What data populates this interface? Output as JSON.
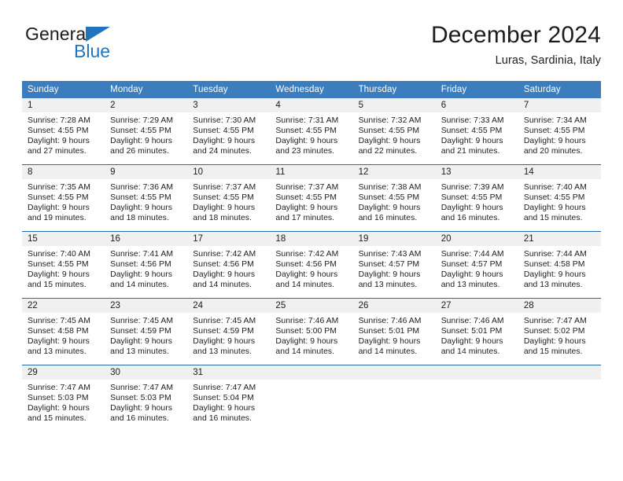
{
  "brand": {
    "name_part1": "General",
    "name_part2": "Blue",
    "triangle_color": "#1f74bd"
  },
  "header": {
    "title": "December 2024",
    "subtitle": "Luras, Sardinia, Italy"
  },
  "theme": {
    "header_bg": "#3b7dbd",
    "header_text": "#ffffff",
    "row_rule": "#2b6ca8",
    "daynum_bg": "#f0f0f0",
    "text": "#1c1c1c",
    "page_bg": "#ffffff"
  },
  "weekday_headers": [
    "Sunday",
    "Monday",
    "Tuesday",
    "Wednesday",
    "Thursday",
    "Friday",
    "Saturday"
  ],
  "weeks": [
    [
      {
        "day": "1",
        "sunrise": "Sunrise: 7:28 AM",
        "sunset": "Sunset: 4:55 PM",
        "daylight1": "Daylight: 9 hours",
        "daylight2": "and 27 minutes."
      },
      {
        "day": "2",
        "sunrise": "Sunrise: 7:29 AM",
        "sunset": "Sunset: 4:55 PM",
        "daylight1": "Daylight: 9 hours",
        "daylight2": "and 26 minutes."
      },
      {
        "day": "3",
        "sunrise": "Sunrise: 7:30 AM",
        "sunset": "Sunset: 4:55 PM",
        "daylight1": "Daylight: 9 hours",
        "daylight2": "and 24 minutes."
      },
      {
        "day": "4",
        "sunrise": "Sunrise: 7:31 AM",
        "sunset": "Sunset: 4:55 PM",
        "daylight1": "Daylight: 9 hours",
        "daylight2": "and 23 minutes."
      },
      {
        "day": "5",
        "sunrise": "Sunrise: 7:32 AM",
        "sunset": "Sunset: 4:55 PM",
        "daylight1": "Daylight: 9 hours",
        "daylight2": "and 22 minutes."
      },
      {
        "day": "6",
        "sunrise": "Sunrise: 7:33 AM",
        "sunset": "Sunset: 4:55 PM",
        "daylight1": "Daylight: 9 hours",
        "daylight2": "and 21 minutes."
      },
      {
        "day": "7",
        "sunrise": "Sunrise: 7:34 AM",
        "sunset": "Sunset: 4:55 PM",
        "daylight1": "Daylight: 9 hours",
        "daylight2": "and 20 minutes."
      }
    ],
    [
      {
        "day": "8",
        "sunrise": "Sunrise: 7:35 AM",
        "sunset": "Sunset: 4:55 PM",
        "daylight1": "Daylight: 9 hours",
        "daylight2": "and 19 minutes."
      },
      {
        "day": "9",
        "sunrise": "Sunrise: 7:36 AM",
        "sunset": "Sunset: 4:55 PM",
        "daylight1": "Daylight: 9 hours",
        "daylight2": "and 18 minutes."
      },
      {
        "day": "10",
        "sunrise": "Sunrise: 7:37 AM",
        "sunset": "Sunset: 4:55 PM",
        "daylight1": "Daylight: 9 hours",
        "daylight2": "and 18 minutes."
      },
      {
        "day": "11",
        "sunrise": "Sunrise: 7:37 AM",
        "sunset": "Sunset: 4:55 PM",
        "daylight1": "Daylight: 9 hours",
        "daylight2": "and 17 minutes."
      },
      {
        "day": "12",
        "sunrise": "Sunrise: 7:38 AM",
        "sunset": "Sunset: 4:55 PM",
        "daylight1": "Daylight: 9 hours",
        "daylight2": "and 16 minutes."
      },
      {
        "day": "13",
        "sunrise": "Sunrise: 7:39 AM",
        "sunset": "Sunset: 4:55 PM",
        "daylight1": "Daylight: 9 hours",
        "daylight2": "and 16 minutes."
      },
      {
        "day": "14",
        "sunrise": "Sunrise: 7:40 AM",
        "sunset": "Sunset: 4:55 PM",
        "daylight1": "Daylight: 9 hours",
        "daylight2": "and 15 minutes."
      }
    ],
    [
      {
        "day": "15",
        "sunrise": "Sunrise: 7:40 AM",
        "sunset": "Sunset: 4:55 PM",
        "daylight1": "Daylight: 9 hours",
        "daylight2": "and 15 minutes."
      },
      {
        "day": "16",
        "sunrise": "Sunrise: 7:41 AM",
        "sunset": "Sunset: 4:56 PM",
        "daylight1": "Daylight: 9 hours",
        "daylight2": "and 14 minutes."
      },
      {
        "day": "17",
        "sunrise": "Sunrise: 7:42 AM",
        "sunset": "Sunset: 4:56 PM",
        "daylight1": "Daylight: 9 hours",
        "daylight2": "and 14 minutes."
      },
      {
        "day": "18",
        "sunrise": "Sunrise: 7:42 AM",
        "sunset": "Sunset: 4:56 PM",
        "daylight1": "Daylight: 9 hours",
        "daylight2": "and 14 minutes."
      },
      {
        "day": "19",
        "sunrise": "Sunrise: 7:43 AM",
        "sunset": "Sunset: 4:57 PM",
        "daylight1": "Daylight: 9 hours",
        "daylight2": "and 13 minutes."
      },
      {
        "day": "20",
        "sunrise": "Sunrise: 7:44 AM",
        "sunset": "Sunset: 4:57 PM",
        "daylight1": "Daylight: 9 hours",
        "daylight2": "and 13 minutes."
      },
      {
        "day": "21",
        "sunrise": "Sunrise: 7:44 AM",
        "sunset": "Sunset: 4:58 PM",
        "daylight1": "Daylight: 9 hours",
        "daylight2": "and 13 minutes."
      }
    ],
    [
      {
        "day": "22",
        "sunrise": "Sunrise: 7:45 AM",
        "sunset": "Sunset: 4:58 PM",
        "daylight1": "Daylight: 9 hours",
        "daylight2": "and 13 minutes."
      },
      {
        "day": "23",
        "sunrise": "Sunrise: 7:45 AM",
        "sunset": "Sunset: 4:59 PM",
        "daylight1": "Daylight: 9 hours",
        "daylight2": "and 13 minutes."
      },
      {
        "day": "24",
        "sunrise": "Sunrise: 7:45 AM",
        "sunset": "Sunset: 4:59 PM",
        "daylight1": "Daylight: 9 hours",
        "daylight2": "and 13 minutes."
      },
      {
        "day": "25",
        "sunrise": "Sunrise: 7:46 AM",
        "sunset": "Sunset: 5:00 PM",
        "daylight1": "Daylight: 9 hours",
        "daylight2": "and 14 minutes."
      },
      {
        "day": "26",
        "sunrise": "Sunrise: 7:46 AM",
        "sunset": "Sunset: 5:01 PM",
        "daylight1": "Daylight: 9 hours",
        "daylight2": "and 14 minutes."
      },
      {
        "day": "27",
        "sunrise": "Sunrise: 7:46 AM",
        "sunset": "Sunset: 5:01 PM",
        "daylight1": "Daylight: 9 hours",
        "daylight2": "and 14 minutes."
      },
      {
        "day": "28",
        "sunrise": "Sunrise: 7:47 AM",
        "sunset": "Sunset: 5:02 PM",
        "daylight1": "Daylight: 9 hours",
        "daylight2": "and 15 minutes."
      }
    ],
    [
      {
        "day": "29",
        "sunrise": "Sunrise: 7:47 AM",
        "sunset": "Sunset: 5:03 PM",
        "daylight1": "Daylight: 9 hours",
        "daylight2": "and 15 minutes."
      },
      {
        "day": "30",
        "sunrise": "Sunrise: 7:47 AM",
        "sunset": "Sunset: 5:03 PM",
        "daylight1": "Daylight: 9 hours",
        "daylight2": "and 16 minutes."
      },
      {
        "day": "31",
        "sunrise": "Sunrise: 7:47 AM",
        "sunset": "Sunset: 5:04 PM",
        "daylight1": "Daylight: 9 hours",
        "daylight2": "and 16 minutes."
      },
      {
        "day": "",
        "sunrise": "",
        "sunset": "",
        "daylight1": "",
        "daylight2": ""
      },
      {
        "day": "",
        "sunrise": "",
        "sunset": "",
        "daylight1": "",
        "daylight2": ""
      },
      {
        "day": "",
        "sunrise": "",
        "sunset": "",
        "daylight1": "",
        "daylight2": ""
      },
      {
        "day": "",
        "sunrise": "",
        "sunset": "",
        "daylight1": "",
        "daylight2": ""
      }
    ]
  ]
}
